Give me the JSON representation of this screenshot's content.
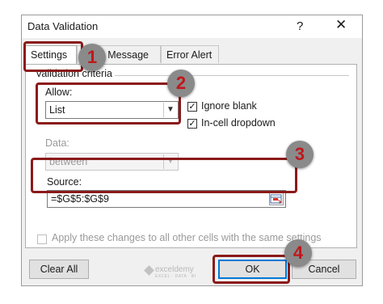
{
  "dialog": {
    "title": "Data Validation",
    "help": "?",
    "close": "✕"
  },
  "tabs": [
    "Settings",
    "Input Message",
    "Error Alert"
  ],
  "validation_criteria": {
    "section_label": "Validation criteria",
    "allow_label": "Allow:",
    "allow_value": "List",
    "data_label": "Data:",
    "data_value": "between",
    "ignore_blank_label": "Ignore blank",
    "ignore_blank_checked": true,
    "in_cell_dropdown_label": "In-cell dropdown",
    "in_cell_dropdown_checked": true,
    "source_label": "Source:",
    "source_value": "=$G$5:$G$9"
  },
  "apply_all_label": "Apply these changes to all other cells with the same settings",
  "buttons": {
    "clear_all": "Clear All",
    "ok": "OK",
    "cancel": "Cancel"
  },
  "annotations": [
    "1",
    "2",
    "3",
    "4"
  ],
  "annotation_color": "#c0171b",
  "highlight_color": "#8b1a1a",
  "watermark": {
    "name": "exceldemy",
    "tagline": "EXCEL · DATA · BI"
  },
  "icons": {
    "dropdown": "chevron-down-icon",
    "check": "check-icon",
    "range_picker": "range-selector-icon",
    "close": "close-icon",
    "help": "help-icon"
  }
}
